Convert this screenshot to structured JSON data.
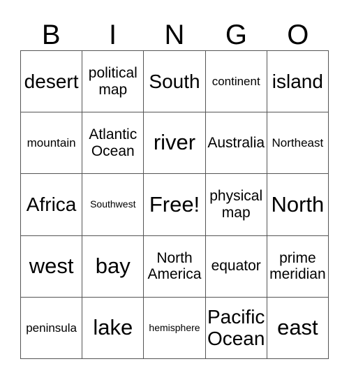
{
  "header": [
    "B",
    "I",
    "N",
    "G",
    "O"
  ],
  "rows": [
    [
      {
        "text": "desert",
        "size": "l"
      },
      {
        "text": "political map",
        "size": "m"
      },
      {
        "text": "South",
        "size": "l"
      },
      {
        "text": "continent",
        "size": "s"
      },
      {
        "text": "island",
        "size": "l"
      }
    ],
    [
      {
        "text": "mountain",
        "size": "s"
      },
      {
        "text": "Atlantic Ocean",
        "size": "m"
      },
      {
        "text": "river",
        "size": "xl"
      },
      {
        "text": "Australia",
        "size": "m"
      },
      {
        "text": "Northeast",
        "size": "s"
      }
    ],
    [
      {
        "text": "Africa",
        "size": "l"
      },
      {
        "text": "Southwest",
        "size": "xs"
      },
      {
        "text": "Free!",
        "size": "xl"
      },
      {
        "text": "physical map",
        "size": "m"
      },
      {
        "text": "North",
        "size": "xl"
      }
    ],
    [
      {
        "text": "west",
        "size": "xl"
      },
      {
        "text": "bay",
        "size": "xl"
      },
      {
        "text": "North America",
        "size": "m"
      },
      {
        "text": "equator",
        "size": "m"
      },
      {
        "text": "prime meridian",
        "size": "m"
      }
    ],
    [
      {
        "text": "peninsula",
        "size": "s"
      },
      {
        "text": "lake",
        "size": "xl"
      },
      {
        "text": "hemisphere",
        "size": "xs"
      },
      {
        "text": "Pacific Ocean",
        "size": "l"
      },
      {
        "text": "east",
        "size": "xl"
      }
    ]
  ]
}
